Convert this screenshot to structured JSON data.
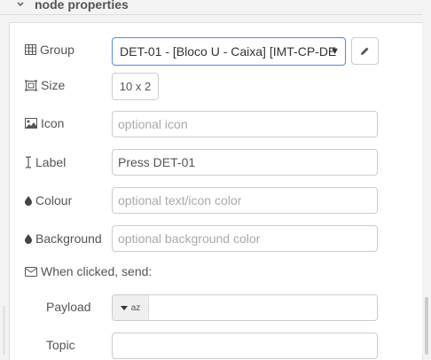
{
  "section": {
    "title": "node properties"
  },
  "group": {
    "label": "Group",
    "value": "DET-01 - [Bloco U - Caixa] [IMT-CP-DE"
  },
  "size": {
    "label": "Size",
    "value": "10 x 2"
  },
  "icon": {
    "label": "Icon",
    "placeholder": "optional icon"
  },
  "label_field": {
    "label": "Label",
    "value": "Press DET-01"
  },
  "colour": {
    "label": "Colour",
    "placeholder": "optional text/icon color"
  },
  "background": {
    "label": "Background",
    "placeholder": "optional background color"
  },
  "when_clicked": {
    "label": "When clicked, send:"
  },
  "payload": {
    "label": "Payload",
    "type_icon": "az",
    "value": ""
  },
  "topic": {
    "label": "Topic",
    "value": ""
  },
  "icons": {
    "section_toggle": "chevron-down-icon",
    "group": "table-icon",
    "size": "resize-icon",
    "icon": "image-icon",
    "label": "i-cursor-icon",
    "colour": "tint-icon",
    "background": "tint-icon",
    "when_clicked": "envelope-icon",
    "edit": "pencil-icon",
    "type_caret": "caret-down-icon"
  }
}
